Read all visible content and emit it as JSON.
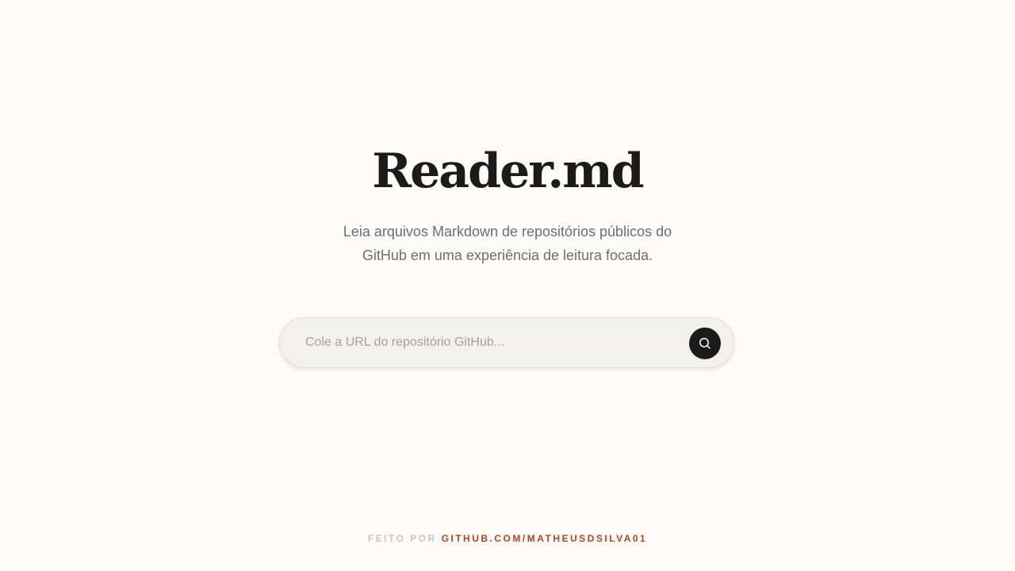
{
  "hero": {
    "title": "Reader.md",
    "subtitle": "Leia arquivos Markdown de repositórios públicos do GitHub em uma experiência de leitura focada."
  },
  "search": {
    "value": "",
    "placeholder": "Cole a URL do repositório GitHub...",
    "button_icon": "search-icon"
  },
  "footer": {
    "label": "FEITO POR",
    "link_text": "GITHUB.COM/MATHEUSDSILVA01"
  },
  "colors": {
    "background": "#fcfbf9",
    "title": "#1b1b1b",
    "subtitle": "#6e6e73",
    "search_background": "#f3f1ec",
    "button": "#1b1b1b",
    "footer_label": "#c9c6c3",
    "accent_link": "#b5461e"
  }
}
